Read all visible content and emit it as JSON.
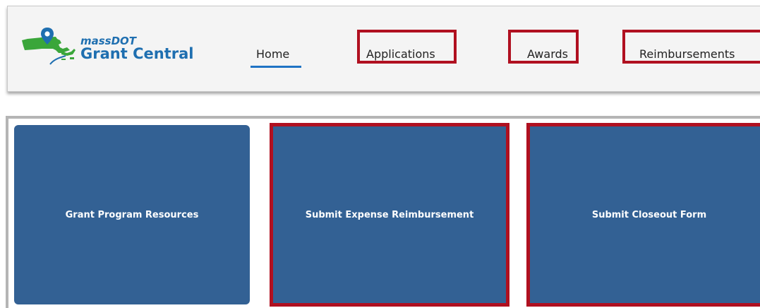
{
  "brand": {
    "line1": "massDOT",
    "line2": "Grant Central"
  },
  "nav": {
    "home": "Home",
    "applications": "Applications",
    "awards": "Awards",
    "reimbursements": "Reimbursements",
    "active": "Home"
  },
  "tiles": [
    {
      "label": "Grant Program Resources"
    },
    {
      "label": "Submit Expense Reimbursement"
    },
    {
      "label": "Submit Closeout Form"
    }
  ],
  "colors": {
    "brand_blue": "#1f6fb0",
    "map_green": "#3aa63a",
    "tile_blue": "#336194",
    "highlight_red": "#b01020",
    "active_underline": "#1f73c4"
  },
  "icons": {
    "logo": "massachusetts-map-pin-icon"
  }
}
